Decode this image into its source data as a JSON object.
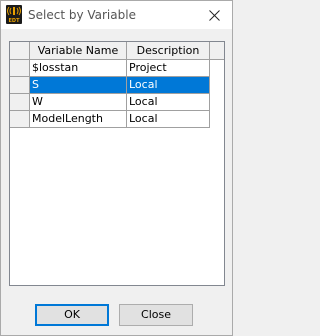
{
  "window": {
    "title": "Select by Variable",
    "app_icon": "edt-app-icon",
    "app_icon_label": "EDT"
  },
  "grid": {
    "columns": [
      "Variable Name",
      "Description"
    ],
    "rows": [
      {
        "name": "$losstan",
        "description": "Project",
        "selected": false
      },
      {
        "name": "S",
        "description": "Local",
        "selected": true
      },
      {
        "name": "W",
        "description": "Local",
        "selected": false
      },
      {
        "name": "ModelLength",
        "description": "Local",
        "selected": false
      }
    ]
  },
  "buttons": {
    "ok_label": "OK",
    "close_label": "Close"
  },
  "colors": {
    "selection": "#0078d7",
    "title_text": "#555555"
  }
}
